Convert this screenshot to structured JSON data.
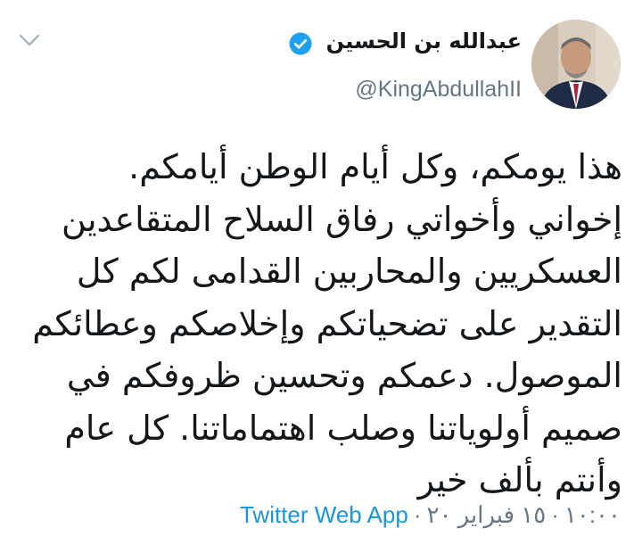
{
  "author": {
    "display_name": "عبدالله بن الحسين",
    "handle": "@KingAbdullahII",
    "verified_icon": "verified-badge-icon"
  },
  "tweet": {
    "lines": [
      "هذا يومكم، وكل أيام الوطن أيامكم.",
      "إخواني وأخواتي رفاق السلاح المتقاعدين",
      "العسكريين والمحاربين القدامى لكم كل",
      "التقدير على تضحياتكم وإخلاصكم وعطائكم",
      "الموصول. دعمكم وتحسين ظروفكم في",
      "صميم أولوياتنا وصلب اهتماماتنا. كل عام",
      "وأنتم بألف خير"
    ]
  },
  "meta": {
    "time": "١٠:٠٠",
    "date": "١٥ فبراير ٢٠",
    "separator": "·",
    "source": "Twitter Web App"
  },
  "colors": {
    "text": "#14171a",
    "secondary": "#657786",
    "link": "#1b95e0",
    "verified": "#1da1f2"
  }
}
